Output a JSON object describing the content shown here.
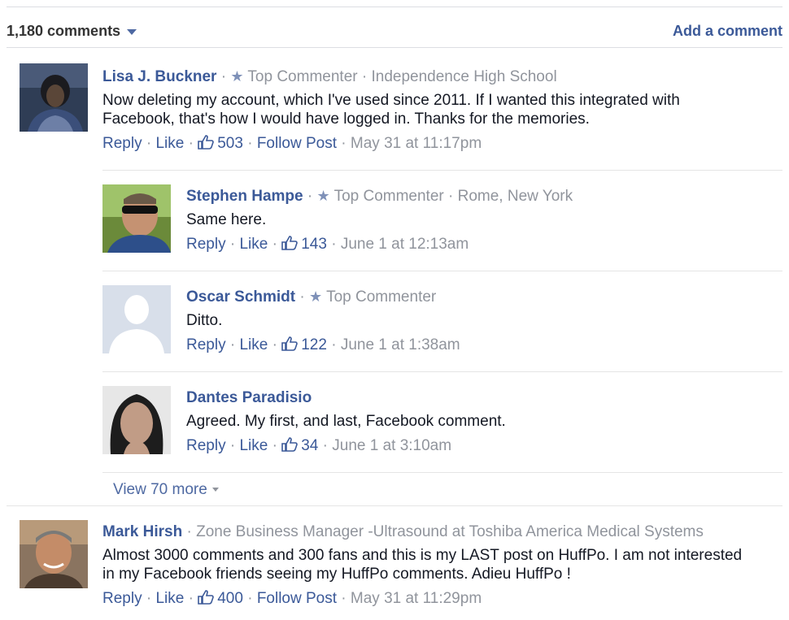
{
  "header": {
    "comment_count": "1,180 comments",
    "add_comment": "Add a comment"
  },
  "icons": {
    "sort": "caret-down-icon",
    "top_commenter": "star-icon",
    "like": "thumbs-up-icon"
  },
  "colors": {
    "link": "#3b5998",
    "meta": "#90949c",
    "divider": "#e5e5e5"
  },
  "labels": {
    "reply": "Reply",
    "like": "Like",
    "follow_post": "Follow Post",
    "top_commenter": "Top Commenter"
  },
  "comments": [
    {
      "name": "Lisa J. Buckner",
      "subtitle": "Independence High School",
      "text": "Now deleting my account, which I've used since 2011. If I wanted this integrated with Facebook, that's how I would have logged in. Thanks for the memories.",
      "likes": "503",
      "time": "May 31 at 11:17pm"
    },
    {
      "name": "Stephen Hampe",
      "subtitle": "Rome, New York",
      "text": "Same here.",
      "likes": "143",
      "time": "June 1 at 12:13am"
    },
    {
      "name": "Oscar Schmidt",
      "text": "Ditto.",
      "likes": "122",
      "time": "June 1 at 1:38am"
    },
    {
      "name": "Dantes Paradisio",
      "text": "Agreed. My first, and last, Facebook comment.",
      "likes": "34",
      "time": "June 1 at 3:10am"
    },
    {
      "name": "Mark Hirsh",
      "subtitle": "Zone Business Manager -Ultrasound at Toshiba America Medical Systems",
      "text": "Almost 3000 comments and 300 fans and this is my LAST post on HuffPo. I am not interested in my Facebook friends seeing my HuffPo comments. Adieu HuffPo !",
      "likes": "400",
      "time": "May 31 at 11:29pm"
    }
  ],
  "view_more": "View 70 more"
}
